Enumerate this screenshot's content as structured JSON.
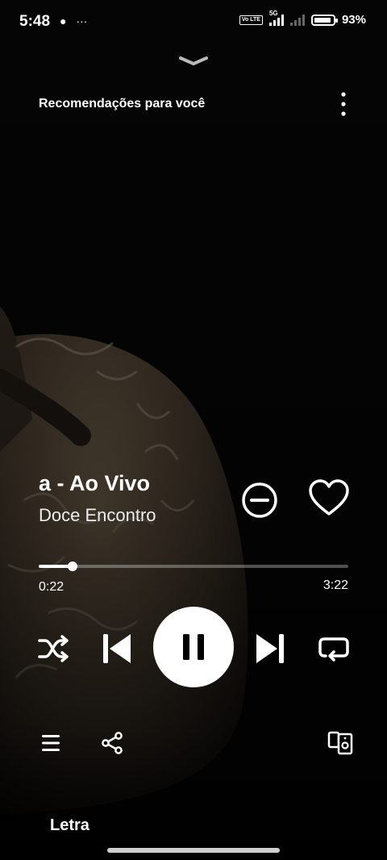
{
  "status_bar": {
    "time": "5:48",
    "notification_icons": [
      "chat-bubble-icon",
      "more-dots-icon"
    ],
    "network_badge": "Vo LTE",
    "network_type": "5G",
    "battery_level": 0.93,
    "battery_text": "93%"
  },
  "header": {
    "context_title": "Recomendações para você",
    "collapse_icon": "chevron-down-icon",
    "menu_icon": "more-vertical-icon"
  },
  "track": {
    "title": "a - Ao Vivo",
    "artist": "Doce Encontro"
  },
  "playback": {
    "elapsed": "0:22",
    "total": "3:22",
    "progress": 0.109,
    "state": "playing"
  },
  "controls": [
    "shuffle-icon",
    "previous-icon",
    "pause-icon",
    "next-icon",
    "repeat-icon"
  ],
  "bottom": {
    "lyrics_label": "Letra"
  },
  "colors": {
    "background": "#000000",
    "accent": "#ffffff"
  }
}
